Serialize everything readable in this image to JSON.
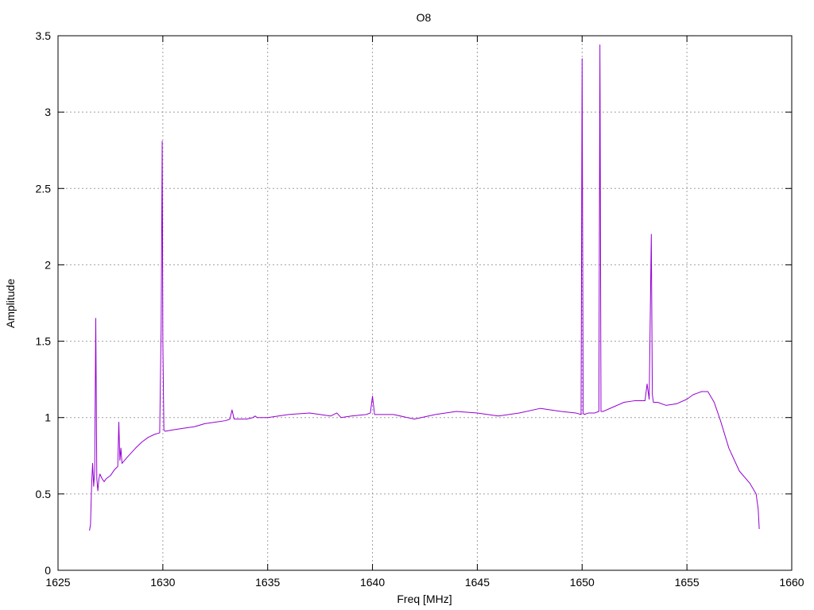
{
  "chart_data": {
    "type": "line",
    "title": "O8",
    "xlabel": "Freq [MHz]",
    "ylabel": "Amplitude",
    "xlim": [
      1625,
      1660
    ],
    "ylim": [
      0,
      3.5
    ],
    "xticks": [
      "1625",
      "1630",
      "1635",
      "1640",
      "1645",
      "1650",
      "1655",
      "1660"
    ],
    "yticks": [
      "0",
      "0.5",
      "1",
      "1.5",
      "2",
      "2.5",
      "3",
      "3.5"
    ],
    "grid": true,
    "line_color": "#9400d3",
    "series": [
      {
        "x": [
          1626.5,
          1626.55,
          1626.6,
          1626.65,
          1626.7,
          1626.75,
          1626.8,
          1626.85,
          1626.9,
          1626.95,
          1627.0,
          1627.1,
          1627.2,
          1627.3,
          1627.5,
          1627.7,
          1627.85,
          1627.9,
          1627.95,
          1628.0,
          1628.05,
          1628.3,
          1628.7,
          1629.0,
          1629.3,
          1629.6,
          1629.85,
          1629.92,
          1629.97,
          1630.0,
          1630.05,
          1630.1,
          1630.5,
          1631.0,
          1631.5,
          1632.0,
          1632.5,
          1633.0,
          1633.2,
          1633.3,
          1633.4,
          1634.0,
          1634.3,
          1634.4,
          1634.5,
          1635.0,
          1636.0,
          1637.0,
          1638.0,
          1638.3,
          1638.5,
          1639.0,
          1639.7,
          1639.9,
          1640.0,
          1640.1,
          1640.5,
          1641.0,
          1642.0,
          1643.0,
          1644.0,
          1645.0,
          1646.0,
          1647.0,
          1648.0,
          1648.5,
          1649.0,
          1649.7,
          1649.95,
          1650.0,
          1650.05,
          1650.1,
          1650.3,
          1650.6,
          1650.8,
          1650.85,
          1650.9,
          1651.0,
          1651.5,
          1652.0,
          1652.5,
          1653.0,
          1653.1,
          1653.2,
          1653.3,
          1653.35,
          1653.4,
          1653.6,
          1654.0,
          1654.5,
          1655.0,
          1655.3,
          1655.5,
          1655.7,
          1656.0,
          1656.3,
          1656.6,
          1657.0,
          1657.5,
          1658.0,
          1658.3,
          1658.4,
          1658.45
        ],
        "y": [
          0.26,
          0.3,
          0.55,
          0.7,
          0.55,
          0.65,
          1.65,
          0.6,
          0.52,
          0.6,
          0.63,
          0.6,
          0.58,
          0.6,
          0.62,
          0.66,
          0.68,
          0.97,
          0.72,
          0.8,
          0.7,
          0.74,
          0.8,
          0.84,
          0.87,
          0.89,
          0.9,
          1.6,
          2.81,
          1.5,
          0.92,
          0.91,
          0.92,
          0.93,
          0.94,
          0.96,
          0.97,
          0.98,
          0.99,
          1.05,
          0.99,
          0.99,
          1.0,
          1.01,
          1.0,
          1.0,
          1.02,
          1.03,
          1.01,
          1.03,
          1.0,
          1.01,
          1.02,
          1.03,
          1.14,
          1.02,
          1.02,
          1.02,
          0.99,
          1.02,
          1.04,
          1.03,
          1.01,
          1.03,
          1.06,
          1.05,
          1.04,
          1.03,
          1.02,
          3.35,
          1.03,
          1.02,
          1.03,
          1.03,
          1.04,
          3.44,
          1.04,
          1.04,
          1.07,
          1.1,
          1.11,
          1.11,
          1.22,
          1.12,
          2.2,
          1.15,
          1.1,
          1.1,
          1.08,
          1.09,
          1.12,
          1.15,
          1.16,
          1.17,
          1.17,
          1.1,
          0.98,
          0.8,
          0.65,
          0.57,
          0.5,
          0.4,
          0.27
        ]
      }
    ]
  }
}
